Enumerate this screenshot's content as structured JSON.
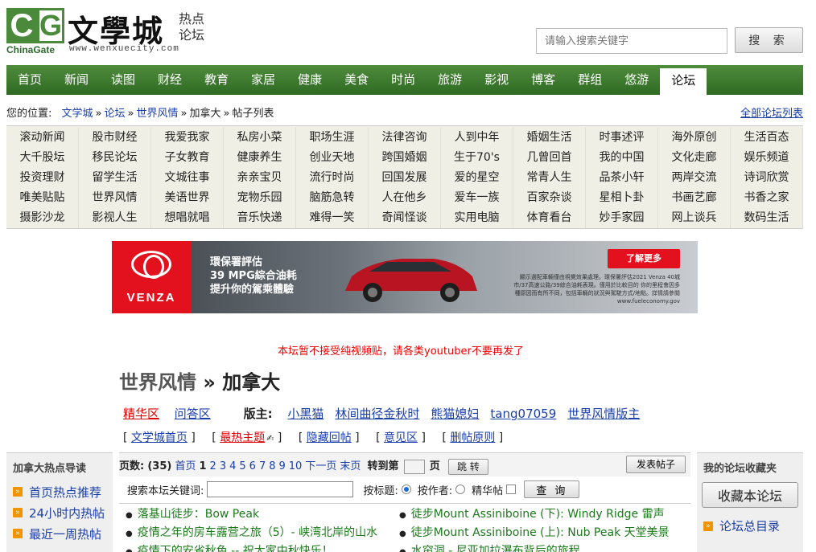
{
  "header": {
    "logo_c": "C",
    "logo_g": "G",
    "logo_chinagate": "ChinaGate",
    "logo_url": "www.wenxuecity.com",
    "logo_main": "文學城",
    "logo_sub": "热点论坛",
    "search_placeholder": "请输入搜索关键字",
    "search_button": "搜 索"
  },
  "nav": [
    "首页",
    "新闻",
    "读图",
    "财经",
    "教育",
    "家居",
    "健康",
    "美食",
    "时尚",
    "旅游",
    "影视",
    "博客",
    "群组",
    "悠游",
    "论坛"
  ],
  "breadcrumb": {
    "label": "您的位置:",
    "items": [
      "文学城",
      "论坛",
      "世界风情",
      "加拿大",
      "帖子列表"
    ],
    "all_forums": "全部论坛列表"
  },
  "categories": [
    "滚动新闻",
    "股市财经",
    "我爱我家",
    "私房小菜",
    "职场生涯",
    "法律咨询",
    "人到中年",
    "婚姻生活",
    "时事述评",
    "海外原创",
    "生活百态",
    "大千股坛",
    "移民论坛",
    "子女教育",
    "健康养生",
    "创业天地",
    "跨国婚姻",
    "生于70's",
    "几曾回首",
    "我的中国",
    "文化走廊",
    "娱乐频道",
    "投资理财",
    "留学生活",
    "文城往事",
    "亲亲宝贝",
    "流行时尚",
    "回国发展",
    "爱的星空",
    "常青人生",
    "品茶小轩",
    "两岸交流",
    "诗词欣赏",
    "唯美贴贴",
    "世界风情",
    "美语世界",
    "宠物乐园",
    "脑筋急转",
    "人在他乡",
    "爱车一族",
    "百家杂谈",
    "星相卜卦",
    "书画艺廊",
    "书香之家",
    "摄影沙龙",
    "影视人生",
    "想唱就唱",
    "音乐快递",
    "难得一笑",
    "奇闻怪谈",
    "实用电脑",
    "体育看台",
    "妙手家园",
    "网上谈兵",
    "数码生活"
  ],
  "banner": {
    "brand": "VENZA",
    "line1": "環保署評估",
    "line2": "39 MPG綜合油耗",
    "line3": "提升你的駕乘體驗",
    "cta": "了解更多",
    "fine_print": "顯示選配車輛僅由視覺效果處理。環保署評估2021 Venza 40城市/37高速公路/39綜合油耗表現。僅用於比較目的 你的里程會因多種原因而有所不同，包括車輛的狀況與駕駛方式/地點。詳情請參閱 www.fueleconomy.gov"
  },
  "notice": "本坛暂不接受纯视频贴，请各类youtuber不要再发了",
  "forum": {
    "parent": "世界风情",
    "sep": " » ",
    "name": "加拿大"
  },
  "mods_line": {
    "jinghua": "精华区",
    "wenda": "问答区",
    "label": "版主:",
    "moderators": [
      "小黑猫",
      "林间曲径金秋时",
      "熊猫媳妇",
      "tang07059",
      "世界风情版主"
    ]
  },
  "links_line": [
    "文学城首页",
    "最热主题",
    "隐藏回帖",
    "意见区",
    "删帖原则"
  ],
  "left_sidebar": {
    "title": "加拿大热点导读",
    "items": [
      "首页热点推荐",
      "24小时内热帖",
      "最近一周热帖"
    ]
  },
  "right_sidebar": {
    "title": "我的论坛收藏夹",
    "fav_button": "收藏本论坛",
    "item": "论坛总目录"
  },
  "pager": {
    "label": "页数:",
    "count": "(35)",
    "first": "首页",
    "current": "1",
    "pages": [
      "2",
      "3",
      "4",
      "5",
      "6",
      "7",
      "8",
      "9",
      "10"
    ],
    "next": "下一页",
    "last": "末页",
    "goto_label": "转到第",
    "page_label": "页",
    "goto_button": "跳 转",
    "post_button": "发表帖子"
  },
  "search_bar": {
    "keyword_label": "搜索本坛关键词:",
    "by_title": "按标题:",
    "by_author": "按作者:",
    "jinghua": "精华帖",
    "query_button": "查 询"
  },
  "threads_left": [
    "落基山徒步：Bow Peak",
    "疫情之年的房车露营之旅（5）- 峡湾北岸的山水",
    "疫情下的安省秋色 -- 祝大家中秋快乐！"
  ],
  "threads_right": [
    "徒步Mount Assiniboine (下): Windy Ridge 雷声",
    "徒步Mount Assiniboine (上): Nub Peak 天堂美景",
    "水帘洞 - 尼亚加拉瀑布背后的旅程"
  ],
  "colors": {
    "nav_green": "#3a7a2e",
    "link_blue": "#1a3fa8",
    "thread_green": "#1a7a1a",
    "notice_red": "#ee0000",
    "bullet_orange": "#f29400"
  }
}
